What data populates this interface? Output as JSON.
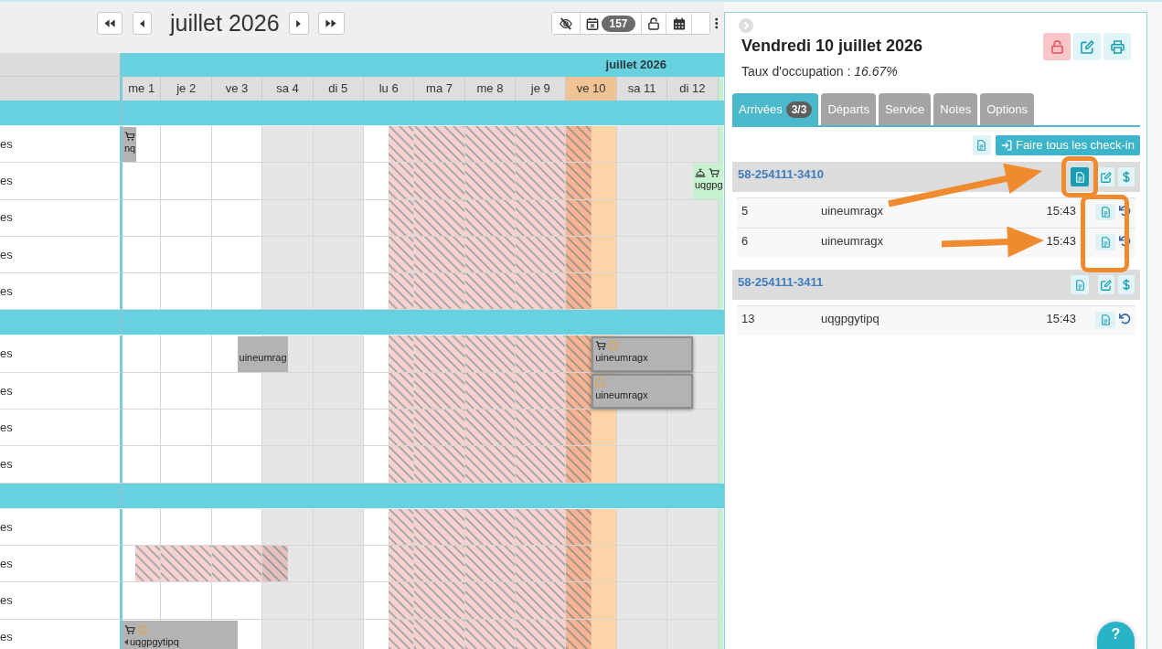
{
  "toolbar": {
    "title": "juillet 2026",
    "badge": "157"
  },
  "calendar": {
    "month": "juillet 2026",
    "days": [
      {
        "label": "me 1",
        "weekend": false,
        "selected": false
      },
      {
        "label": "je 2",
        "weekend": false,
        "selected": false
      },
      {
        "label": "ve 3",
        "weekend": false,
        "selected": false
      },
      {
        "label": "sa 4",
        "weekend": true,
        "selected": false
      },
      {
        "label": "di 5",
        "weekend": true,
        "selected": false
      },
      {
        "label": "lu 6",
        "weekend": false,
        "selected": false
      },
      {
        "label": "ma 7",
        "weekend": false,
        "selected": false
      },
      {
        "label": "me 8",
        "weekend": false,
        "selected": false
      },
      {
        "label": "je 9",
        "weekend": false,
        "selected": false
      },
      {
        "label": "ve 10",
        "weekend": false,
        "selected": true
      },
      {
        "label": "sa 11",
        "weekend": true,
        "selected": false
      },
      {
        "label": "di 12",
        "weekend": true,
        "selected": false
      }
    ],
    "groups": [
      {
        "rows": [
          {
            "label": "es",
            "cells": [
              {
                "kind": "checkout",
                "booking": {
                  "label": "nq",
                  "color": "#b3b3b3",
                  "highlighted": false,
                  "markers": [
                    {
                      "kind": "cart"
                    }
                  ]
                }
              },
              {
                "kind": "free"
              },
              {
                "kind": "free"
              },
              {
                "kind": "free"
              },
              {
                "kind": "free"
              },
              {
                "kind": "closing"
              },
              {
                "kind": "closed"
              },
              {
                "kind": "closed"
              },
              {
                "kind": "closed"
              },
              {
                "kind": "reopening"
              },
              {
                "kind": "free"
              },
              {
                "kind": "free"
              }
            ]
          },
          {
            "label": "es",
            "cells": [
              {
                "kind": "free"
              },
              {
                "kind": "free"
              },
              {
                "kind": "free"
              },
              {
                "kind": "free"
              },
              {
                "kind": "free"
              },
              {
                "kind": "closing"
              },
              {
                "kind": "closed"
              },
              {
                "kind": "closed"
              },
              {
                "kind": "closed"
              },
              {
                "kind": "reopening"
              },
              {
                "kind": "free"
              },
              {
                "kind": "checkin",
                "booking": {
                  "label": "uqgpg",
                  "color": "#c6f2cf",
                  "highlighted": false,
                  "markers": [
                    {
                      "kind": "bell"
                    },
                    {
                      "kind": "cart"
                    }
                  ]
                }
              }
            ]
          },
          {
            "label": "es",
            "cells": [
              {
                "kind": "free"
              },
              {
                "kind": "free"
              },
              {
                "kind": "free"
              },
              {
                "kind": "free"
              },
              {
                "kind": "free"
              },
              {
                "kind": "closing"
              },
              {
                "kind": "closed"
              },
              {
                "kind": "closed"
              },
              {
                "kind": "closed"
              },
              {
                "kind": "reopening"
              },
              {
                "kind": "free"
              },
              {
                "kind": "free"
              }
            ]
          },
          {
            "label": "es",
            "cells": [
              {
                "kind": "free"
              },
              {
                "kind": "free"
              },
              {
                "kind": "free"
              },
              {
                "kind": "free"
              },
              {
                "kind": "free"
              },
              {
                "kind": "closing"
              },
              {
                "kind": "closed"
              },
              {
                "kind": "closed"
              },
              {
                "kind": "closed"
              },
              {
                "kind": "reopening"
              },
              {
                "kind": "free"
              },
              {
                "kind": "free"
              }
            ]
          },
          {
            "label": "es",
            "cells": [
              {
                "kind": "free"
              },
              {
                "kind": "free"
              },
              {
                "kind": "free"
              },
              {
                "kind": "free"
              },
              {
                "kind": "free"
              },
              {
                "kind": "closing"
              },
              {
                "kind": "closed"
              },
              {
                "kind": "closed"
              },
              {
                "kind": "closed"
              },
              {
                "kind": "reopening"
              },
              {
                "kind": "free"
              },
              {
                "kind": "free"
              }
            ]
          }
        ]
      },
      {
        "rows": [
          {
            "label": "es",
            "cells": [
              {
                "kind": "free"
              },
              {
                "kind": "free"
              },
              {
                "kind": "checkin",
                "booking": {
                  "label": "uineumrag",
                  "color": "#b3b3b3",
                  "highlighted": false
                }
              },
              {
                "kind": "checkout"
              },
              {
                "kind": "free"
              },
              {
                "kind": "closing"
              },
              {
                "kind": "closed"
              },
              {
                "kind": "closed"
              },
              {
                "kind": "closed"
              },
              {
                "kind": "turnover",
                "booking": {
                  "label": "uineumragx",
                  "color": "#b3b3b3",
                  "highlighted": true,
                  "markers": [
                    {
                      "kind": "cart"
                    },
                    {
                      "kind": "ring"
                    }
                  ]
                }
              },
              {
                "kind": "booked"
              },
              {
                "kind": "checkout"
              }
            ]
          },
          {
            "label": "es",
            "cells": [
              {
                "kind": "free"
              },
              {
                "kind": "free"
              },
              {
                "kind": "free"
              },
              {
                "kind": "free"
              },
              {
                "kind": "free"
              },
              {
                "kind": "closing"
              },
              {
                "kind": "closed"
              },
              {
                "kind": "closed"
              },
              {
                "kind": "closed"
              },
              {
                "kind": "turnover",
                "booking": {
                  "label": "uineumragx",
                  "color": "#b3b3b3",
                  "highlighted": true,
                  "markers": [
                    {
                      "kind": "ring"
                    }
                  ]
                }
              },
              {
                "kind": "booked"
              },
              {
                "kind": "checkout"
              }
            ]
          },
          {
            "label": "es",
            "cells": [
              {
                "kind": "free"
              },
              {
                "kind": "free"
              },
              {
                "kind": "free"
              },
              {
                "kind": "free"
              },
              {
                "kind": "free"
              },
              {
                "kind": "closing"
              },
              {
                "kind": "closed"
              },
              {
                "kind": "closed"
              },
              {
                "kind": "closed"
              },
              {
                "kind": "reopening"
              },
              {
                "kind": "free"
              },
              {
                "kind": "free"
              }
            ]
          },
          {
            "label": "es",
            "cells": [
              {
                "kind": "free"
              },
              {
                "kind": "free"
              },
              {
                "kind": "free"
              },
              {
                "kind": "free"
              },
              {
                "kind": "free"
              },
              {
                "kind": "closing"
              },
              {
                "kind": "closed"
              },
              {
                "kind": "closed"
              },
              {
                "kind": "closed"
              },
              {
                "kind": "reopening"
              },
              {
                "kind": "free"
              },
              {
                "kind": "free"
              }
            ]
          }
        ]
      },
      {
        "rows": [
          {
            "label": "es",
            "cells": [
              {
                "kind": "free"
              },
              {
                "kind": "free"
              },
              {
                "kind": "free"
              },
              {
                "kind": "free"
              },
              {
                "kind": "free"
              },
              {
                "kind": "closing"
              },
              {
                "kind": "closed"
              },
              {
                "kind": "closed"
              },
              {
                "kind": "closed"
              },
              {
                "kind": "reopening"
              },
              {
                "kind": "free"
              },
              {
                "kind": "free"
              }
            ]
          },
          {
            "label": "es",
            "cells": [
              {
                "kind": "closing"
              },
              {
                "kind": "closed"
              },
              {
                "kind": "closed"
              },
              {
                "kind": "reopening"
              },
              {
                "kind": "free"
              },
              {
                "kind": "closing"
              },
              {
                "kind": "closed"
              },
              {
                "kind": "closed"
              },
              {
                "kind": "closed"
              },
              {
                "kind": "reopening"
              },
              {
                "kind": "free"
              },
              {
                "kind": "free"
              }
            ]
          },
          {
            "label": "es",
            "cells": [
              {
                "kind": "free"
              },
              {
                "kind": "free"
              },
              {
                "kind": "free"
              },
              {
                "kind": "free"
              },
              {
                "kind": "free"
              },
              {
                "kind": "closing"
              },
              {
                "kind": "closed"
              },
              {
                "kind": "closed"
              },
              {
                "kind": "closed"
              },
              {
                "kind": "reopening"
              },
              {
                "kind": "free"
              },
              {
                "kind": "free"
              }
            ]
          },
          {
            "label": "es",
            "cells": [
              {
                "kind": "booked",
                "booking": {
                  "label": "uqgpgytipq",
                  "color": "#b3b3b3",
                  "highlighted": false,
                  "markers": [
                    {
                      "kind": "cart"
                    },
                    {
                      "kind": "ring"
                    },
                    {
                      "kind": "continues"
                    }
                  ]
                }
              },
              {
                "kind": "booked"
              },
              {
                "kind": "checkout"
              },
              {
                "kind": "free"
              },
              {
                "kind": "free"
              },
              {
                "kind": "closing"
              },
              {
                "kind": "closed"
              },
              {
                "kind": "closed"
              },
              {
                "kind": "closed"
              },
              {
                "kind": "reopening"
              },
              {
                "kind": "free"
              },
              {
                "kind": "free"
              }
            ]
          }
        ]
      }
    ]
  },
  "day_panel": {
    "title": "Vendredi 10 juillet 2026",
    "occupancy": "Taux d'occupation : *16.67%*",
    "tabs": [
      {
        "label": "Arrivées",
        "badge": "3/3",
        "selected": true
      },
      {
        "label": "Départs",
        "selected": false
      },
      {
        "label": "Service",
        "selected": false
      },
      {
        "label": "Notes",
        "selected": false
      },
      {
        "label": "Options",
        "selected": false
      }
    ],
    "check_in_all": "Faire tous les check-in",
    "reservations": [
      {
        "number": "58-254111-3410",
        "document_highlighted": true,
        "guests": [
          {
            "room": "5",
            "name": "uineumragx",
            "time": "15:43"
          },
          {
            "room": "6",
            "name": "uineumragx",
            "time": "15:43"
          }
        ]
      },
      {
        "number": "58-254111-3411",
        "document_highlighted": false,
        "guests": [
          {
            "room": "13",
            "name": "uqgpgytipq",
            "time": "15:43"
          }
        ]
      }
    ]
  },
  "annotations": [
    {
      "kind": "frame"
    },
    {
      "kind": "frame"
    },
    {
      "kind": "arrow"
    },
    {
      "kind": "arrow"
    }
  ],
  "help_button": {
    "label": "?"
  }
}
